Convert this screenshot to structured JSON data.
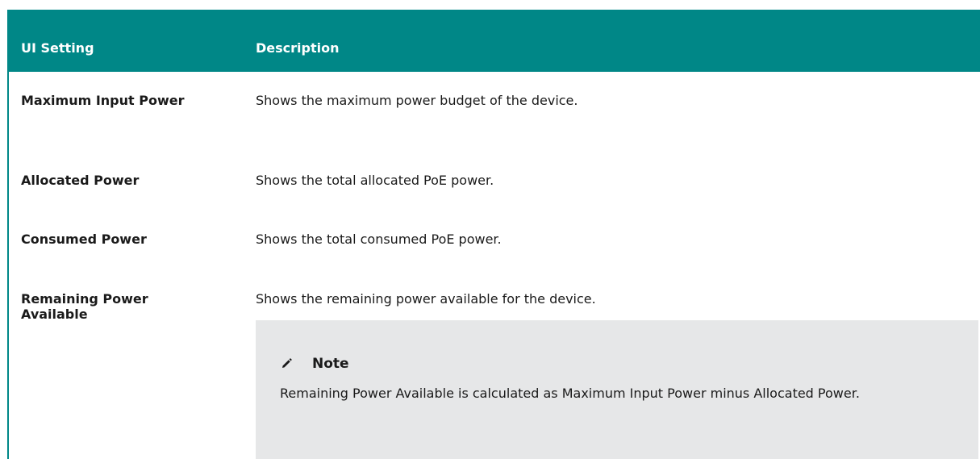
{
  "table": {
    "headers": {
      "setting": "UI Setting",
      "description": "Description"
    },
    "rows": [
      {
        "setting": "Maximum Input Power",
        "description": "Shows the maximum power budget of the device."
      },
      {
        "setting": "Allocated Power",
        "description": "Shows the total allocated PoE power."
      },
      {
        "setting": "Consumed Power",
        "description": "Shows the total consumed PoE power."
      },
      {
        "setting": "Remaining Power Available",
        "description": "Shows the remaining power available for the device."
      }
    ]
  },
  "note": {
    "icon": "pencil-icon",
    "title": "Note",
    "body": "Remaining Power Available is calculated as Maximum Input Power minus Allocated Power."
  },
  "colors": {
    "header_bg": "#008787",
    "header_text": "#ffffff",
    "note_bg": "#e6e7e8"
  }
}
